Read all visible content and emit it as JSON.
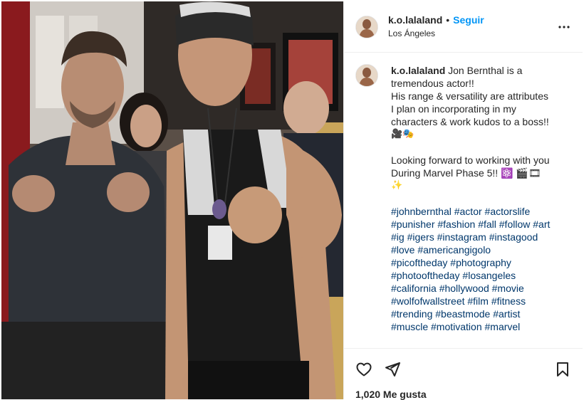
{
  "post": {
    "username": "k.o.lalaland",
    "follow_label": "Seguir",
    "location": "Los Ángeles",
    "more_label": "•••"
  },
  "caption": {
    "username": "k.o.lalaland",
    "line1": "Jon Bernthal is a",
    "line2": "tremendous actor!!",
    "line3": "His range & versatility are attributes",
    "line4": "I plan on incorporating in my",
    "line5": "characters & work kudos to a boss!!",
    "line6": "🎥🎭",
    "line7": "Looking forward to working with you",
    "line8": "During Marvel Phase 5!! ⚛️ 🎬🎞",
    "line9": "✨",
    "hashtags": [
      "#johnbernthal #actor #actorslife",
      "#punisher #fashion #fall #follow #art",
      "#ig #igers #instagram #instagood",
      "#love #americangigolo",
      "#picoftheday #photography",
      "#photooftheday #losangeles",
      "#california #hollywood #movie",
      "#wolfofwallstreet #film #fitness",
      "#trending #beastmode #artist",
      "#muscle #motivation #marvel"
    ]
  },
  "footer": {
    "likes": "1,020 Me gusta"
  },
  "icons": {
    "like": "heart-icon",
    "share": "paper-plane-icon",
    "save": "bookmark-icon",
    "more": "more-options-icon"
  },
  "colors": {
    "link": "#0095f6",
    "hashtag": "#00376b",
    "text": "#262626",
    "divider": "#efefef"
  }
}
